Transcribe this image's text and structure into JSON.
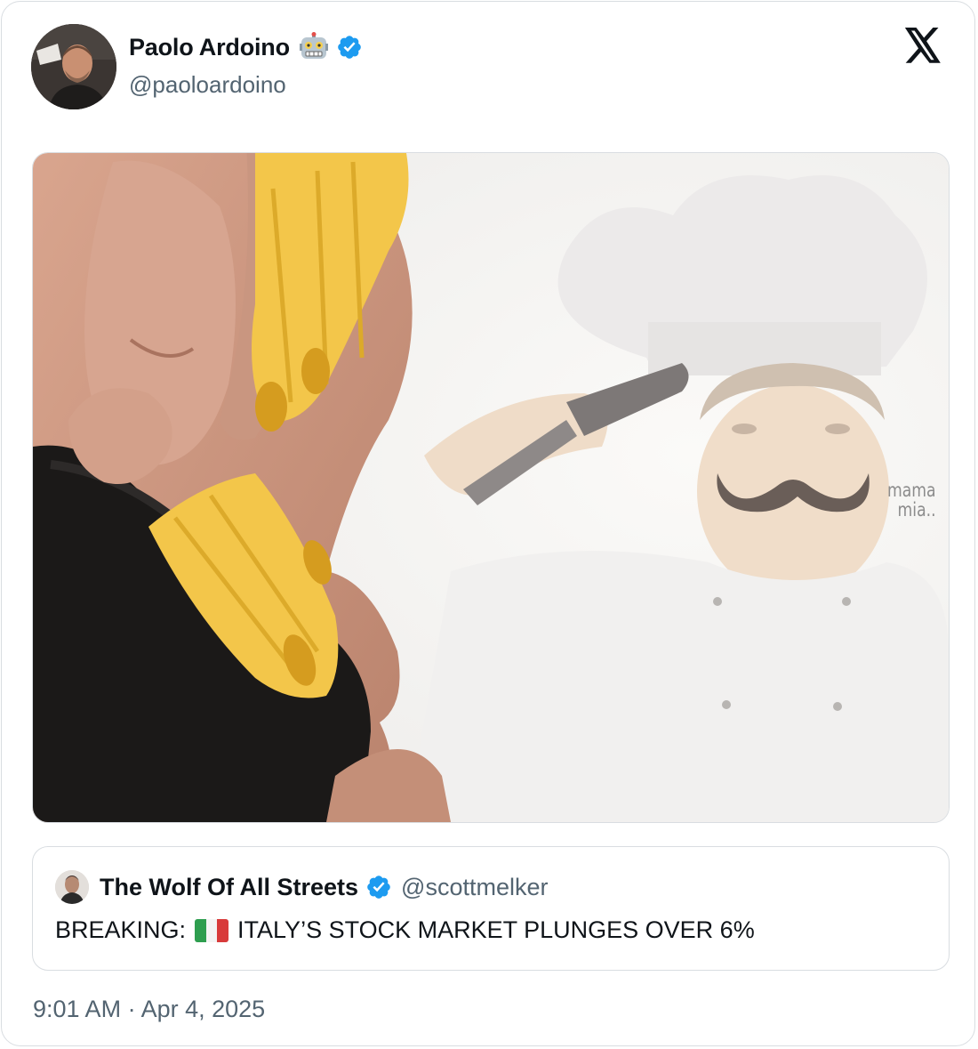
{
  "tweet": {
    "author": {
      "display_name": "Paolo Ardoino",
      "handle": "@paoloardoino",
      "emoji_icon": "robot-face-icon",
      "verified_color": "#1d9bf0"
    },
    "platform_logo": "x-logo-icon",
    "media": {
      "caption_line1": "mama",
      "caption_line2": "mia..",
      "description_icon": "meme-image"
    },
    "quoted": {
      "display_name": "The Wolf Of All Streets",
      "handle": "@scottmelker",
      "text_before": "BREAKING:",
      "flag_icon": "italy-flag-icon",
      "text_after": "ITALY’S STOCK MARKET PLUNGES OVER 6%"
    },
    "timestamp": "9:01 AM · Apr 4, 2025"
  },
  "colors": {
    "text_primary": "#0f1419",
    "text_secondary": "#536471",
    "border": "#d9dde1",
    "verified": "#1d9bf0",
    "pasta": "#f3c64a"
  }
}
